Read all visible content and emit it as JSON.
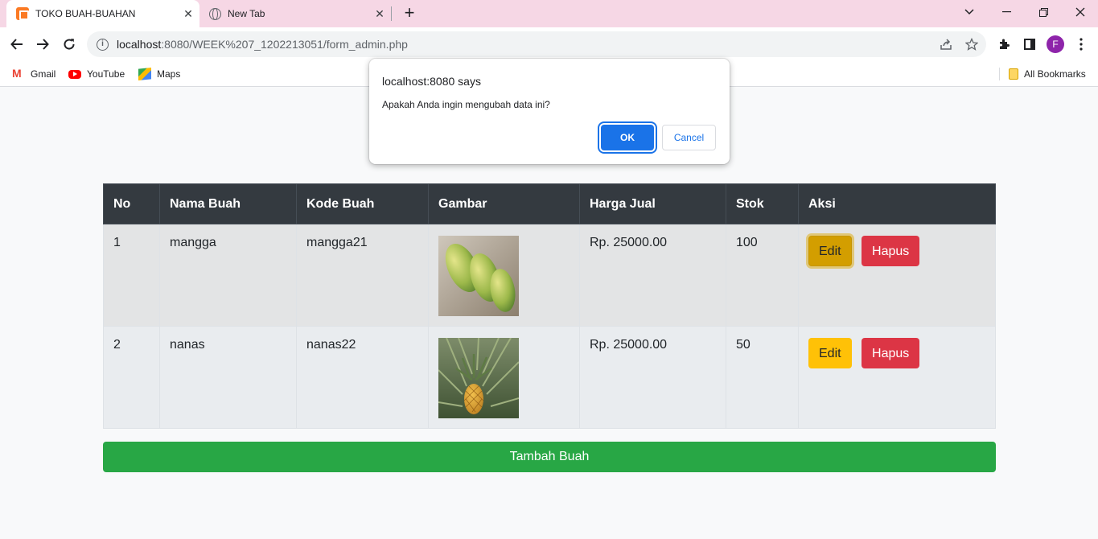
{
  "browser": {
    "tabs": [
      {
        "title": "TOKO BUAH-BUAHAN",
        "active": true
      },
      {
        "title": "New Tab",
        "active": false
      }
    ],
    "url_host": "localhost",
    "url_rest": ":8080/WEEK%207_1202213051/form_admin.php",
    "profile_initial": "F",
    "bookmarks": [
      {
        "label": "Gmail",
        "icon": "gmail-icon"
      },
      {
        "label": "YouTube",
        "icon": "youtube-icon"
      },
      {
        "label": "Maps",
        "icon": "maps-icon"
      }
    ],
    "all_bookmarks": "All Bookmarks"
  },
  "table": {
    "headers": [
      "No",
      "Nama Buah",
      "Kode Buah",
      "Gambar",
      "Harga Jual",
      "Stok",
      "Aksi"
    ],
    "rows": [
      {
        "no": "1",
        "nama": "mangga",
        "kode": "mangga21",
        "gambar": "mango-image",
        "harga": "Rp. 25000.00",
        "stok": "100"
      },
      {
        "no": "2",
        "nama": "nanas",
        "kode": "nanas22",
        "gambar": "pineapple-image",
        "harga": "Rp. 25000.00",
        "stok": "50"
      }
    ],
    "edit_label": "Edit",
    "delete_label": "Hapus"
  },
  "add_button": "Tambah Buah",
  "dialog": {
    "title": "localhost:8080 says",
    "message": "Apakah Anda ingin mengubah data ini?",
    "ok": "OK",
    "cancel": "Cancel"
  },
  "colors": {
    "header_bg": "#343a40",
    "edit": "#ffc107",
    "delete": "#dc3545",
    "add": "#28a745",
    "dialog_ok": "#1a73e8"
  }
}
